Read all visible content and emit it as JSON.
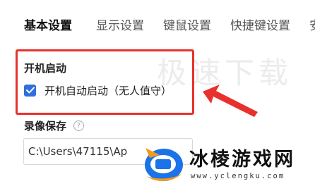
{
  "tabs": [
    {
      "label": "基本设置",
      "active": true
    },
    {
      "label": "显示设置",
      "active": false
    },
    {
      "label": "键鼠设置",
      "active": false
    },
    {
      "label": "快捷键设置",
      "active": false
    },
    {
      "label": "安",
      "active": false
    }
  ],
  "watermark": "极速下载",
  "startup": {
    "title": "开机启动",
    "checkbox_label": "开机自动启动（无人值守）",
    "checked": true
  },
  "recording": {
    "title": "录像保存",
    "help_icon": "help-icon",
    "path_value": "C:\\Users\\47115\\Ap"
  },
  "brand": {
    "name": "冰棱游戏网",
    "url": "www.yclengku.com"
  },
  "colors": {
    "highlight": "#e8312d",
    "checkbox": "#2f6fde",
    "logo_blue": "#1a73e8",
    "logo_orange": "#f39a1e"
  }
}
